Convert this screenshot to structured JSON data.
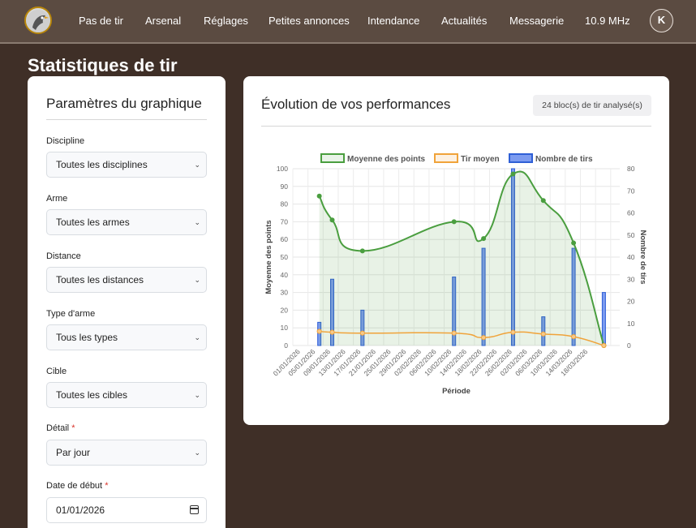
{
  "nav": {
    "items": [
      "Pas de tir",
      "Arsenal",
      "Réglages",
      "Petites annonces",
      "Intendance",
      "Actualités",
      "Messagerie",
      "10.9 MHz"
    ],
    "avatar": "K"
  },
  "page": {
    "title": "Statistiques de tir"
  },
  "params": {
    "title": "Paramètres du graphique",
    "fields": [
      {
        "label": "Discipline",
        "value": "Toutes les disciplines",
        "required": false
      },
      {
        "label": "Arme",
        "value": "Toutes les armes",
        "required": false
      },
      {
        "label": "Distance",
        "value": "Toutes les distances",
        "required": false
      },
      {
        "label": "Type d'arme",
        "value": "Tous les types",
        "required": false
      },
      {
        "label": "Cible",
        "value": "Toutes les cibles",
        "required": false
      },
      {
        "label": "Détail",
        "value": "Par jour",
        "required": true
      },
      {
        "label": "Date de début",
        "value": "01/01/2026",
        "required": true
      }
    ]
  },
  "perf": {
    "title": "Évolution de vos performances",
    "badge": "24 bloc(s) de tir analysé(s)"
  },
  "colors": {
    "green": "#4a9e3f",
    "orange": "#f0a33a",
    "blue": "#4a74e0",
    "nav_bg": "#5b4b41",
    "page_bg": "#3f2f27"
  },
  "chart_data": {
    "type": "line",
    "legend": [
      "Moyenne des points",
      "Tir moyen",
      "Nombre de tirs"
    ],
    "legend_position": "top",
    "categories": [
      "01/01/2026",
      "05/01/2026",
      "09/01/2026",
      "13/01/2026",
      "17/01/2026",
      "21/01/2026",
      "25/01/2026",
      "29/01/2026",
      "02/02/2026",
      "06/02/2026",
      "10/02/2026",
      "14/02/2026",
      "18/02/2026",
      "22/02/2026",
      "26/02/2026",
      "02/03/2026",
      "06/03/2026",
      "10/03/2026",
      "14/03/2026",
      "18/03/2026"
    ],
    "xlabel": "Période",
    "ylabel": "Moyenne des points",
    "y2label": "Nombre de tirs",
    "ylim": [
      0,
      100
    ],
    "y2lim": [
      0,
      80
    ],
    "yticks": [
      0,
      10,
      20,
      30,
      40,
      50,
      60,
      70,
      80,
      90,
      100
    ],
    "y2ticks": [
      0,
      10,
      20,
      30,
      40,
      50,
      60,
      70,
      80
    ],
    "grid": true,
    "x_index_range": [
      0,
      21.6
    ],
    "series": [
      {
        "name": "Moyenne des points",
        "axis": "left",
        "kind": "area-line",
        "points": [
          [
            1.75,
            84.5
          ],
          [
            2.6,
            71
          ],
          [
            4.6,
            53.5
          ],
          [
            10.65,
            70
          ],
          [
            12.6,
            60.5
          ],
          [
            14.55,
            97
          ],
          [
            16.55,
            82
          ],
          [
            18.55,
            58
          ],
          [
            20.55,
            0
          ]
        ]
      },
      {
        "name": "Tir moyen",
        "axis": "left",
        "kind": "line",
        "points": [
          [
            1.75,
            8
          ],
          [
            2.6,
            7.5
          ],
          [
            4.6,
            7
          ],
          [
            10.65,
            7
          ],
          [
            12.6,
            4.5
          ],
          [
            14.55,
            7.5
          ],
          [
            16.55,
            6.5
          ],
          [
            18.55,
            5
          ],
          [
            20.55,
            0
          ]
        ]
      },
      {
        "name": "Nombre de tirs",
        "axis": "right",
        "kind": "bar",
        "points": [
          [
            1.75,
            10.5
          ],
          [
            2.6,
            30
          ],
          [
            4.6,
            16
          ],
          [
            10.65,
            31
          ],
          [
            12.6,
            44
          ],
          [
            14.55,
            80
          ],
          [
            16.55,
            13
          ],
          [
            18.55,
            44
          ],
          [
            20.55,
            24
          ]
        ]
      }
    ]
  }
}
